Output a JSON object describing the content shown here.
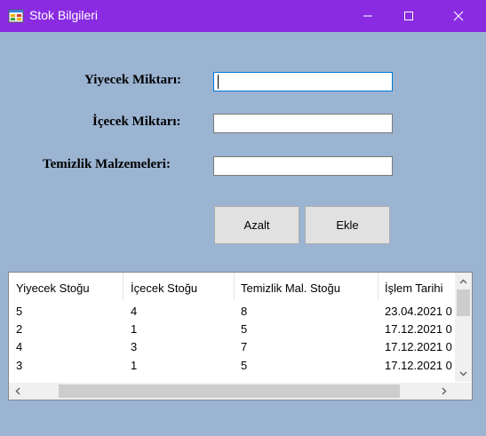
{
  "window": {
    "title": "Stok Bilgileri",
    "icon": "app-icon",
    "controls": [
      "minimize-icon",
      "maximize-icon",
      "close-icon"
    ],
    "colors": {
      "titlebar": "#8a2be2",
      "background": "#9bb4d2"
    }
  },
  "form": {
    "food_label": "Yiyecek Miktarı:",
    "food_value": "",
    "drink_label": "İçecek Miktarı:",
    "drink_value": "",
    "cleaning_label": "Temizlik Malzemeleri:",
    "cleaning_value": ""
  },
  "buttons": {
    "decrease_label": "Azalt",
    "add_label": "Ekle"
  },
  "grid": {
    "columns": [
      "Yiyecek Stoğu",
      "İçecek Stoğu",
      "Temizlik Mal. Stoğu",
      "İşlem Tarihi"
    ],
    "rows": [
      [
        "5",
        "4",
        "8",
        "23.04.2021 0"
      ],
      [
        "2",
        "1",
        "5",
        "17.12.2021 0"
      ],
      [
        "4",
        "3",
        "7",
        "17.12.2021 0"
      ],
      [
        "3",
        "1",
        "5",
        "17.12.2021 0"
      ]
    ]
  }
}
